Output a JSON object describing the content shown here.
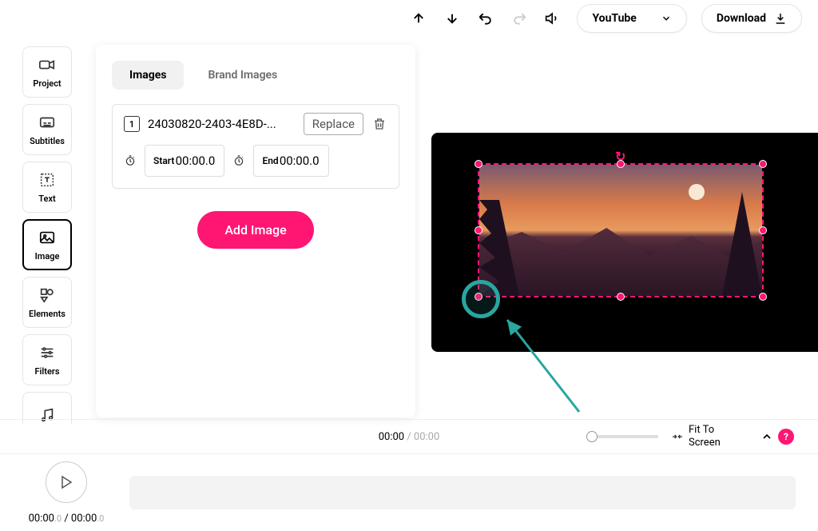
{
  "toolbar": {
    "preset_label": "YouTube",
    "download_label": "Download"
  },
  "sidebar": {
    "tabs": [
      {
        "label": "Project"
      },
      {
        "label": "Subtitles"
      },
      {
        "label": "Text"
      },
      {
        "label": "Image"
      },
      {
        "label": "Elements"
      },
      {
        "label": "Filters"
      }
    ]
  },
  "panel": {
    "tabs": {
      "images": "Images",
      "brand": "Brand Images"
    },
    "item": {
      "index": "1",
      "filename": "24030820-2403-4E8D-...",
      "replace": "Replace",
      "start_label": "Start",
      "start_value": "00:00.0",
      "end_label": "End",
      "end_value": "00:00.0"
    },
    "add_btn": "Add Image"
  },
  "timeline": {
    "current": "00:00",
    "total": "00:00",
    "fit_label": "Fit To Screen",
    "help": "?",
    "play_current_main": "00:00",
    "play_current_frac": ".0",
    "play_total_main": "00:00",
    "play_total_frac": ".0",
    "separator": " / "
  }
}
